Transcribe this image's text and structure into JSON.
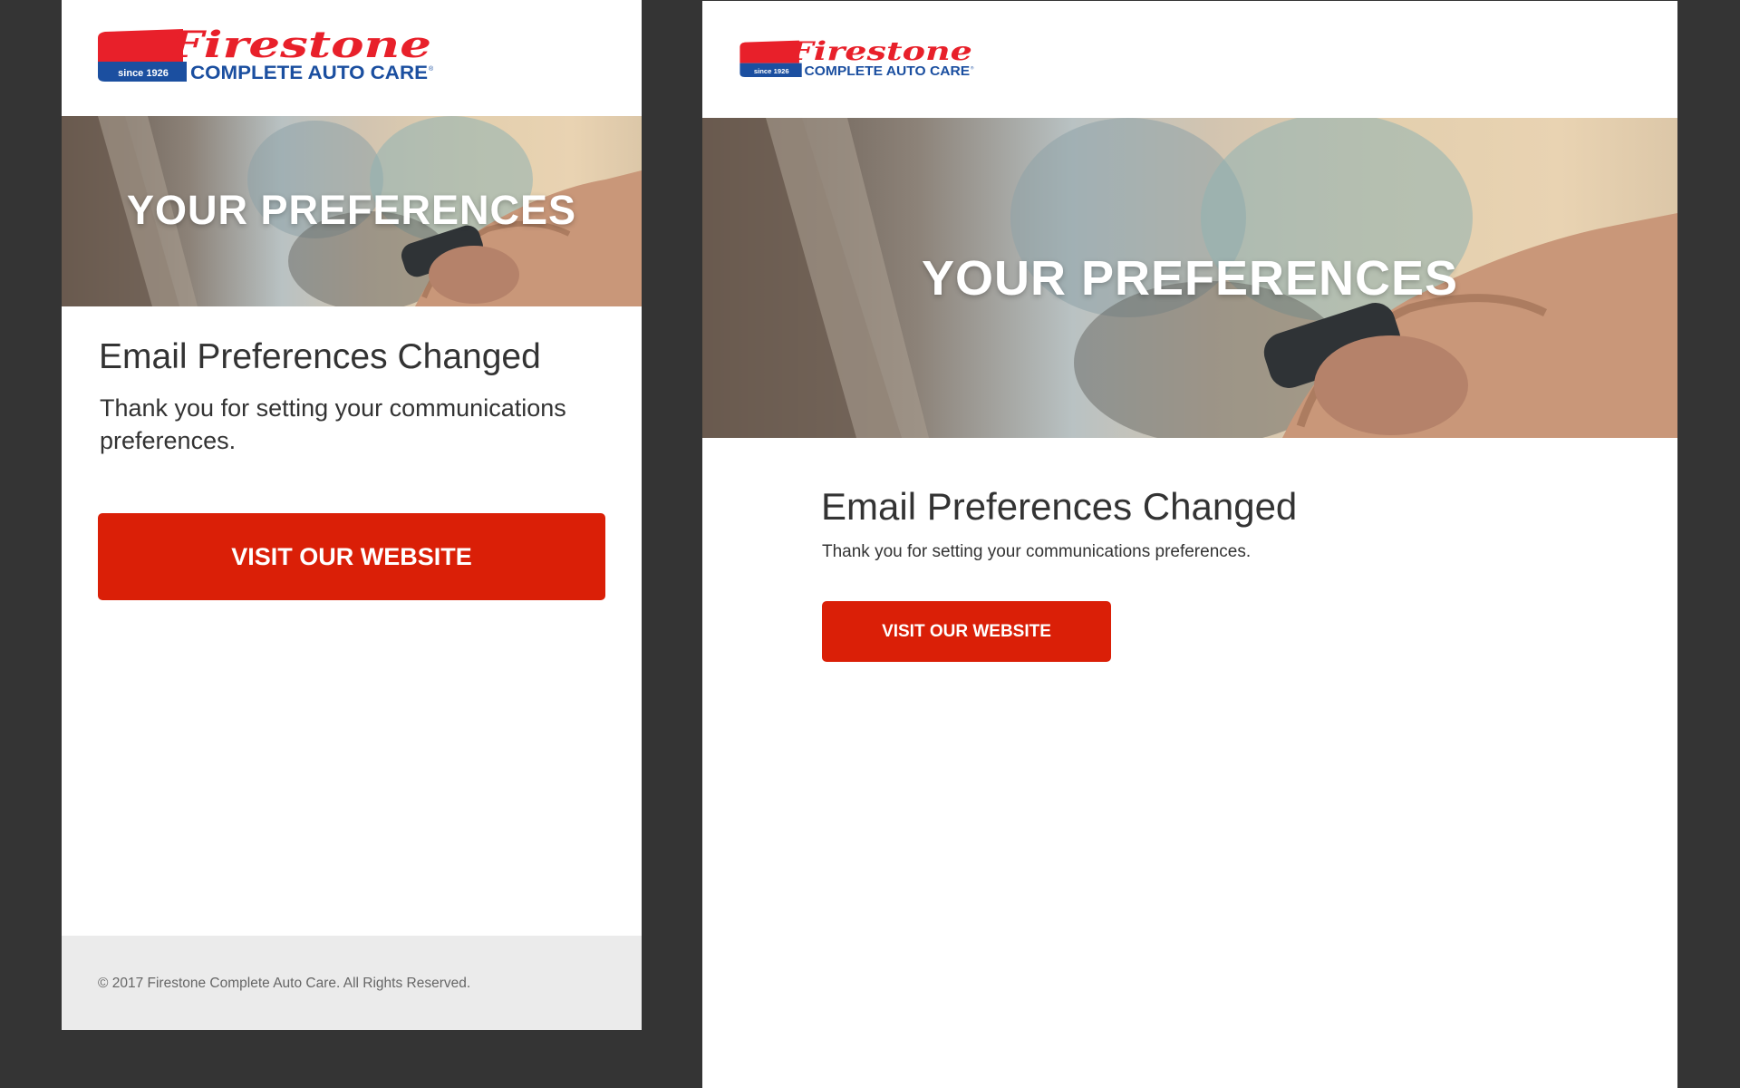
{
  "colors": {
    "page_background": "#343434",
    "card_background": "#ffffff",
    "brand_red": "#e8202a",
    "brand_blue": "#1b4fa0",
    "cta_red": "#da1f07",
    "text_dark": "#333333",
    "footer_background": "#ebebeb",
    "footer_text": "#666666"
  },
  "brand": {
    "name": "Firestone",
    "since": "since 1926",
    "tagline": "COMPLETE AUTO CARE",
    "trademark": "®"
  },
  "hero": {
    "title": "YOUR PREFERENCES",
    "image": "hand-pressing-car-key-fob-photo"
  },
  "content": {
    "heading": "Email Preferences Changed",
    "body": "Thank you for setting your communications preferences.",
    "cta_label": "VISIT OUR WEBSITE"
  },
  "footer": {
    "copyright": "© 2017 Firestone Complete Auto Care. All Rights Reserved."
  }
}
